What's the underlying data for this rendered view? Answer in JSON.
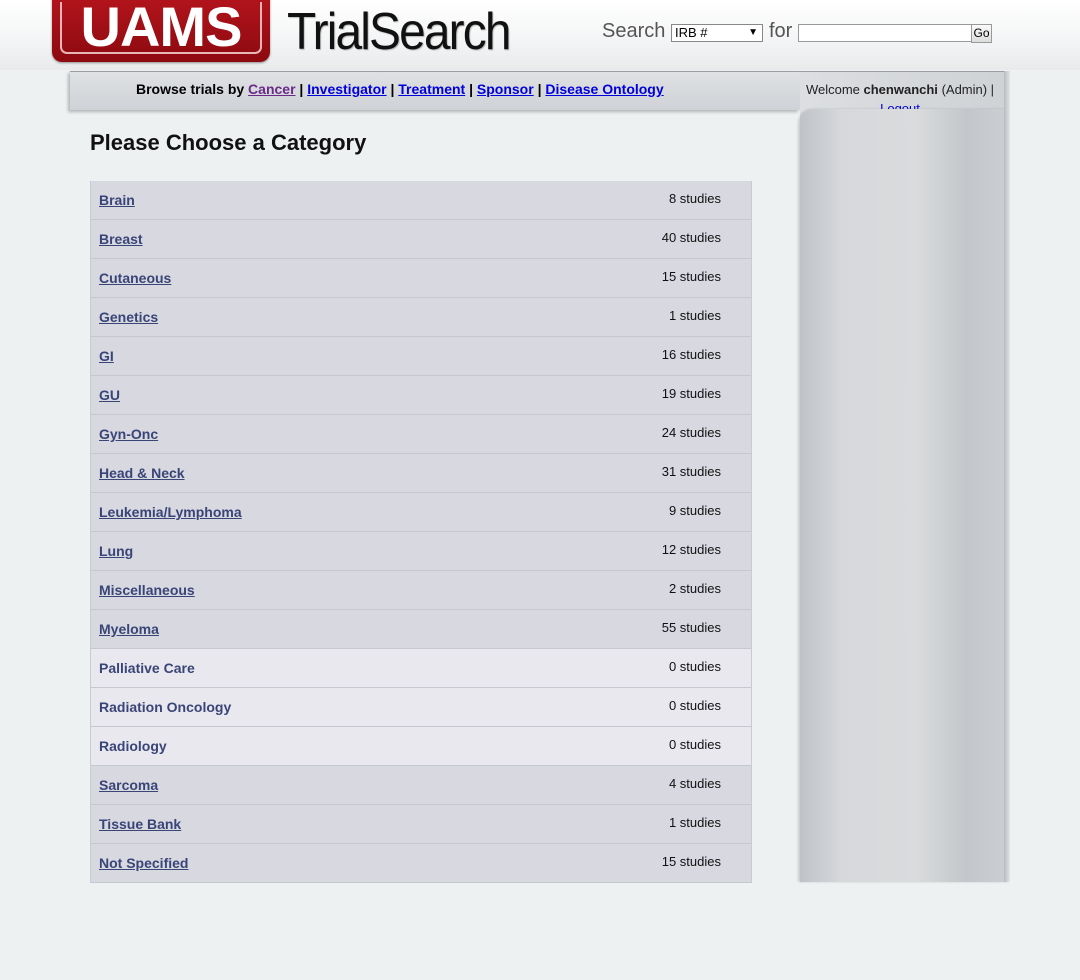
{
  "header": {
    "logo_text": "UAMS",
    "app_name": "TrialSearch",
    "search_label": "Search",
    "search_type": "IRB #",
    "for_label": "for",
    "search_value": "",
    "go_label": "Go"
  },
  "nav": {
    "prefix": "Browse trials by",
    "links": [
      "Cancer",
      "Investigator",
      "Treatment",
      "Sponsor",
      "Disease Ontology"
    ],
    "sep": "|"
  },
  "user": {
    "welcome": "Welcome",
    "username": "chenwanchi",
    "role": "(Admin) |",
    "logout": "Logout"
  },
  "page_title": "Please Choose a Category",
  "categories": [
    {
      "name": "Brain",
      "count": "8 studies",
      "link": true
    },
    {
      "name": "Breast",
      "count": "40 studies",
      "link": true
    },
    {
      "name": "Cutaneous",
      "count": "15 studies",
      "link": true
    },
    {
      "name": "Genetics",
      "count": "1 studies",
      "link": true
    },
    {
      "name": "GI",
      "count": "16 studies",
      "link": true
    },
    {
      "name": "GU",
      "count": "19 studies",
      "link": true
    },
    {
      "name": "Gyn-Onc",
      "count": "24 studies",
      "link": true
    },
    {
      "name": "Head & Neck",
      "count": "31 studies",
      "link": true
    },
    {
      "name": "Leukemia/Lymphoma",
      "count": "9 studies",
      "link": true
    },
    {
      "name": "Lung",
      "count": "12 studies",
      "link": true
    },
    {
      "name": "Miscellaneous",
      "count": "2 studies",
      "link": true
    },
    {
      "name": "Myeloma",
      "count": "55 studies",
      "link": true
    },
    {
      "name": "Palliative Care",
      "count": "0 studies",
      "link": false
    },
    {
      "name": "Radiation Oncology",
      "count": "0 studies",
      "link": false
    },
    {
      "name": "Radiology",
      "count": "0 studies",
      "link": false
    },
    {
      "name": "Sarcoma",
      "count": "4 studies",
      "link": true
    },
    {
      "name": "Tissue Bank",
      "count": "1 studies",
      "link": true
    },
    {
      "name": "Not Specified",
      "count": "15 studies",
      "link": true
    }
  ]
}
